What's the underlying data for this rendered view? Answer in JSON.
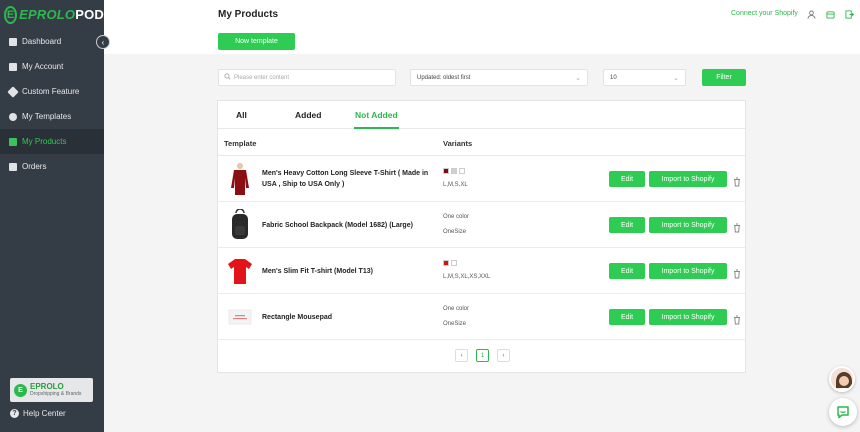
{
  "brand": {
    "name_prefix": "EPROLO",
    "name_suffix": "POD",
    "badge": "E"
  },
  "sidebar": {
    "items": [
      {
        "label": "Dashboard",
        "icon": "dashboard-icon"
      },
      {
        "label": "My Account",
        "icon": "account-icon"
      },
      {
        "label": "Custom Feature",
        "icon": "tools-icon"
      },
      {
        "label": "My Templates",
        "icon": "templates-icon"
      },
      {
        "label": "My Products",
        "icon": "products-icon"
      },
      {
        "label": "Orders",
        "icon": "orders-icon"
      }
    ],
    "active_index": 4,
    "promo": {
      "title": "EPROLO",
      "subtitle": "Dropshipping & Brands",
      "badge": "E"
    },
    "help_label": "Help Center"
  },
  "header": {
    "title": "My Products",
    "connect_label": "Connect your Shopify"
  },
  "toolbar": {
    "new_template_label": "Now template"
  },
  "filters": {
    "search_placeholder": "Please enter content",
    "sort_value": "Updated: oldest first",
    "page_size_value": "10",
    "filter_label": "Filter"
  },
  "tabs": [
    {
      "label": "All"
    },
    {
      "label": "Added"
    },
    {
      "label": "Not Added"
    }
  ],
  "active_tab": 2,
  "table": {
    "columns": [
      "Template",
      "Variants"
    ],
    "edit_label": "Edit",
    "import_label": "Import to Shopify",
    "rows": [
      {
        "name_line1": "Men's Heavy Cotton Long Sleeve T-Shirt ( Made in",
        "name_line2": "USA , Ship to USA Only )",
        "variant_line1": "",
        "variant_line2": "L,M,S,XL",
        "swatches": [
          "#7a0d10",
          "#cfcfcf",
          "#ffffff"
        ],
        "thumb": "longsleeve-shirt-icon"
      },
      {
        "name_line1": "Fabric School Backpack (Model 1682) (Large)",
        "name_line2": "",
        "variant_line1": "One color",
        "variant_line2": "OneSize",
        "swatches": [],
        "thumb": "backpack-icon"
      },
      {
        "name_line1": "Men's Slim Fit T-shirt (Model T13)",
        "name_line2": "",
        "variant_line1": "",
        "variant_line2": "L,M,S,XL,XS,XXL",
        "swatches": [
          "#d90f14",
          "#ffffff"
        ],
        "thumb": "tshirt-icon"
      },
      {
        "name_line1": "Rectangle Mousepad",
        "name_line2": "",
        "variant_line1": "One color",
        "variant_line2": "OneSize",
        "swatches": [],
        "thumb": "mousepad-icon"
      }
    ]
  },
  "pagination": {
    "current": "1",
    "prev": "‹",
    "next": "›"
  },
  "colors": {
    "accent": "#2ecc52",
    "sidebar_bg": "#343c45",
    "active_text": "#37c45a"
  }
}
